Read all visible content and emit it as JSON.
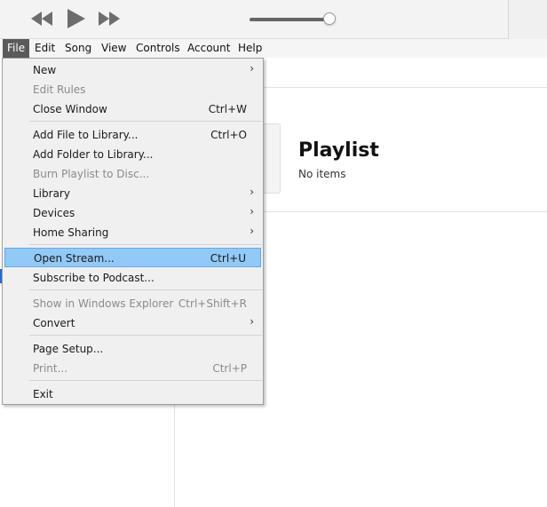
{
  "menubar": {
    "items": [
      "File",
      "Edit",
      "Song",
      "View",
      "Controls",
      "Account",
      "Help"
    ]
  },
  "toolbar": {
    "volume_level": 0.96
  },
  "playlist": {
    "title": "Playlist",
    "subtitle": "No items"
  },
  "file_menu": {
    "new": {
      "label": "New"
    },
    "edit_rules": {
      "label": "Edit Rules"
    },
    "close_window": {
      "label": "Close Window",
      "shortcut": "Ctrl+W"
    },
    "add_file": {
      "label": "Add File to Library...",
      "shortcut": "Ctrl+O"
    },
    "add_folder": {
      "label": "Add Folder to Library..."
    },
    "burn_playlist": {
      "label": "Burn Playlist to Disc..."
    },
    "library": {
      "label": "Library"
    },
    "devices": {
      "label": "Devices"
    },
    "home_sharing": {
      "label": "Home Sharing"
    },
    "open_stream": {
      "label": "Open Stream...",
      "shortcut": "Ctrl+U"
    },
    "subscribe_podcast": {
      "label": "Subscribe to Podcast..."
    },
    "show_explorer": {
      "label": "Show in Windows Explorer",
      "shortcut": "Ctrl+Shift+R"
    },
    "convert": {
      "label": "Convert"
    },
    "page_setup": {
      "label": "Page Setup..."
    },
    "print": {
      "label": "Print...",
      "shortcut": "Ctrl+P"
    },
    "exit": {
      "label": "Exit"
    }
  },
  "colors": {
    "highlight": "#91c9f7",
    "active_menu": "#5a5a5a",
    "disabled_text": "#8a8a8a"
  }
}
